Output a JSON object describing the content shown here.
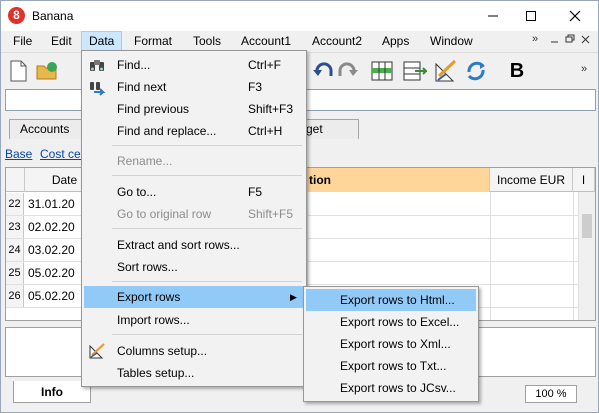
{
  "window": {
    "title": "Banana",
    "app_icon_letter": "8"
  },
  "menubar": {
    "items": [
      "File",
      "Edit",
      "Data",
      "Format",
      "Tools",
      "Account1",
      "Account2",
      "Apps",
      "Window"
    ],
    "overflow": "»"
  },
  "toolbar": {
    "icons": [
      "new-file-icon",
      "open-folder-icon",
      "save-icon",
      "undo-icon",
      "redo-icon",
      "insert-row-icon",
      "delete-row-icon",
      "columns-setup-icon",
      "recheck-icon",
      "bold-icon"
    ],
    "bold_label": "B",
    "overflow": "»"
  },
  "tabs": {
    "items": [
      "Accounts",
      "get"
    ]
  },
  "subtabs": {
    "items": [
      "Base",
      "Cost cen"
    ]
  },
  "grid": {
    "headers": [
      "Date",
      "tion",
      "Income EUR",
      "I"
    ],
    "rows": [
      {
        "num": "22",
        "date": "31.01.20"
      },
      {
        "num": "23",
        "date": "02.02.20"
      },
      {
        "num": "24",
        "date": "03.02.20"
      },
      {
        "num": "25",
        "date": "05.02.20"
      },
      {
        "num": "26",
        "date": "05.02.20"
      }
    ]
  },
  "status": {
    "info_tab": "Info",
    "zoom": "100 %"
  },
  "data_menu": {
    "items": [
      {
        "label": "Find...",
        "shortcut": "Ctrl+F",
        "icon": "binoculars-icon",
        "state": "normal"
      },
      {
        "label": "Find next",
        "shortcut": "F3",
        "icon": "find-next-icon",
        "state": "normal"
      },
      {
        "label": "Find previous",
        "shortcut": "Shift+F3",
        "state": "normal"
      },
      {
        "label": "Find and replace...",
        "shortcut": "Ctrl+H",
        "state": "normal"
      },
      {
        "label": "Rename...",
        "shortcut": "",
        "state": "disabled"
      },
      {
        "label": "Go to...",
        "shortcut": "F5",
        "state": "normal"
      },
      {
        "label": "Go to original row",
        "shortcut": "Shift+F5",
        "state": "disabled"
      },
      {
        "label": "Extract and sort rows...",
        "shortcut": "",
        "state": "normal"
      },
      {
        "label": "Sort rows...",
        "shortcut": "",
        "state": "normal"
      },
      {
        "label": "Export rows",
        "shortcut": "",
        "state": "active",
        "submenu_arrow": "▶"
      },
      {
        "label": "Import rows...",
        "shortcut": "",
        "state": "normal"
      },
      {
        "label": "Columns setup...",
        "shortcut": "",
        "icon": "columns-setup-icon",
        "state": "normal"
      },
      {
        "label": "Tables setup...",
        "shortcut": "",
        "state": "normal"
      }
    ]
  },
  "export_submenu": {
    "items": [
      "Export rows to Html...",
      "Export rows to Excel...",
      "Export rows to Xml...",
      "Export rows to Txt...",
      "Export rows to JCsv..."
    ]
  }
}
